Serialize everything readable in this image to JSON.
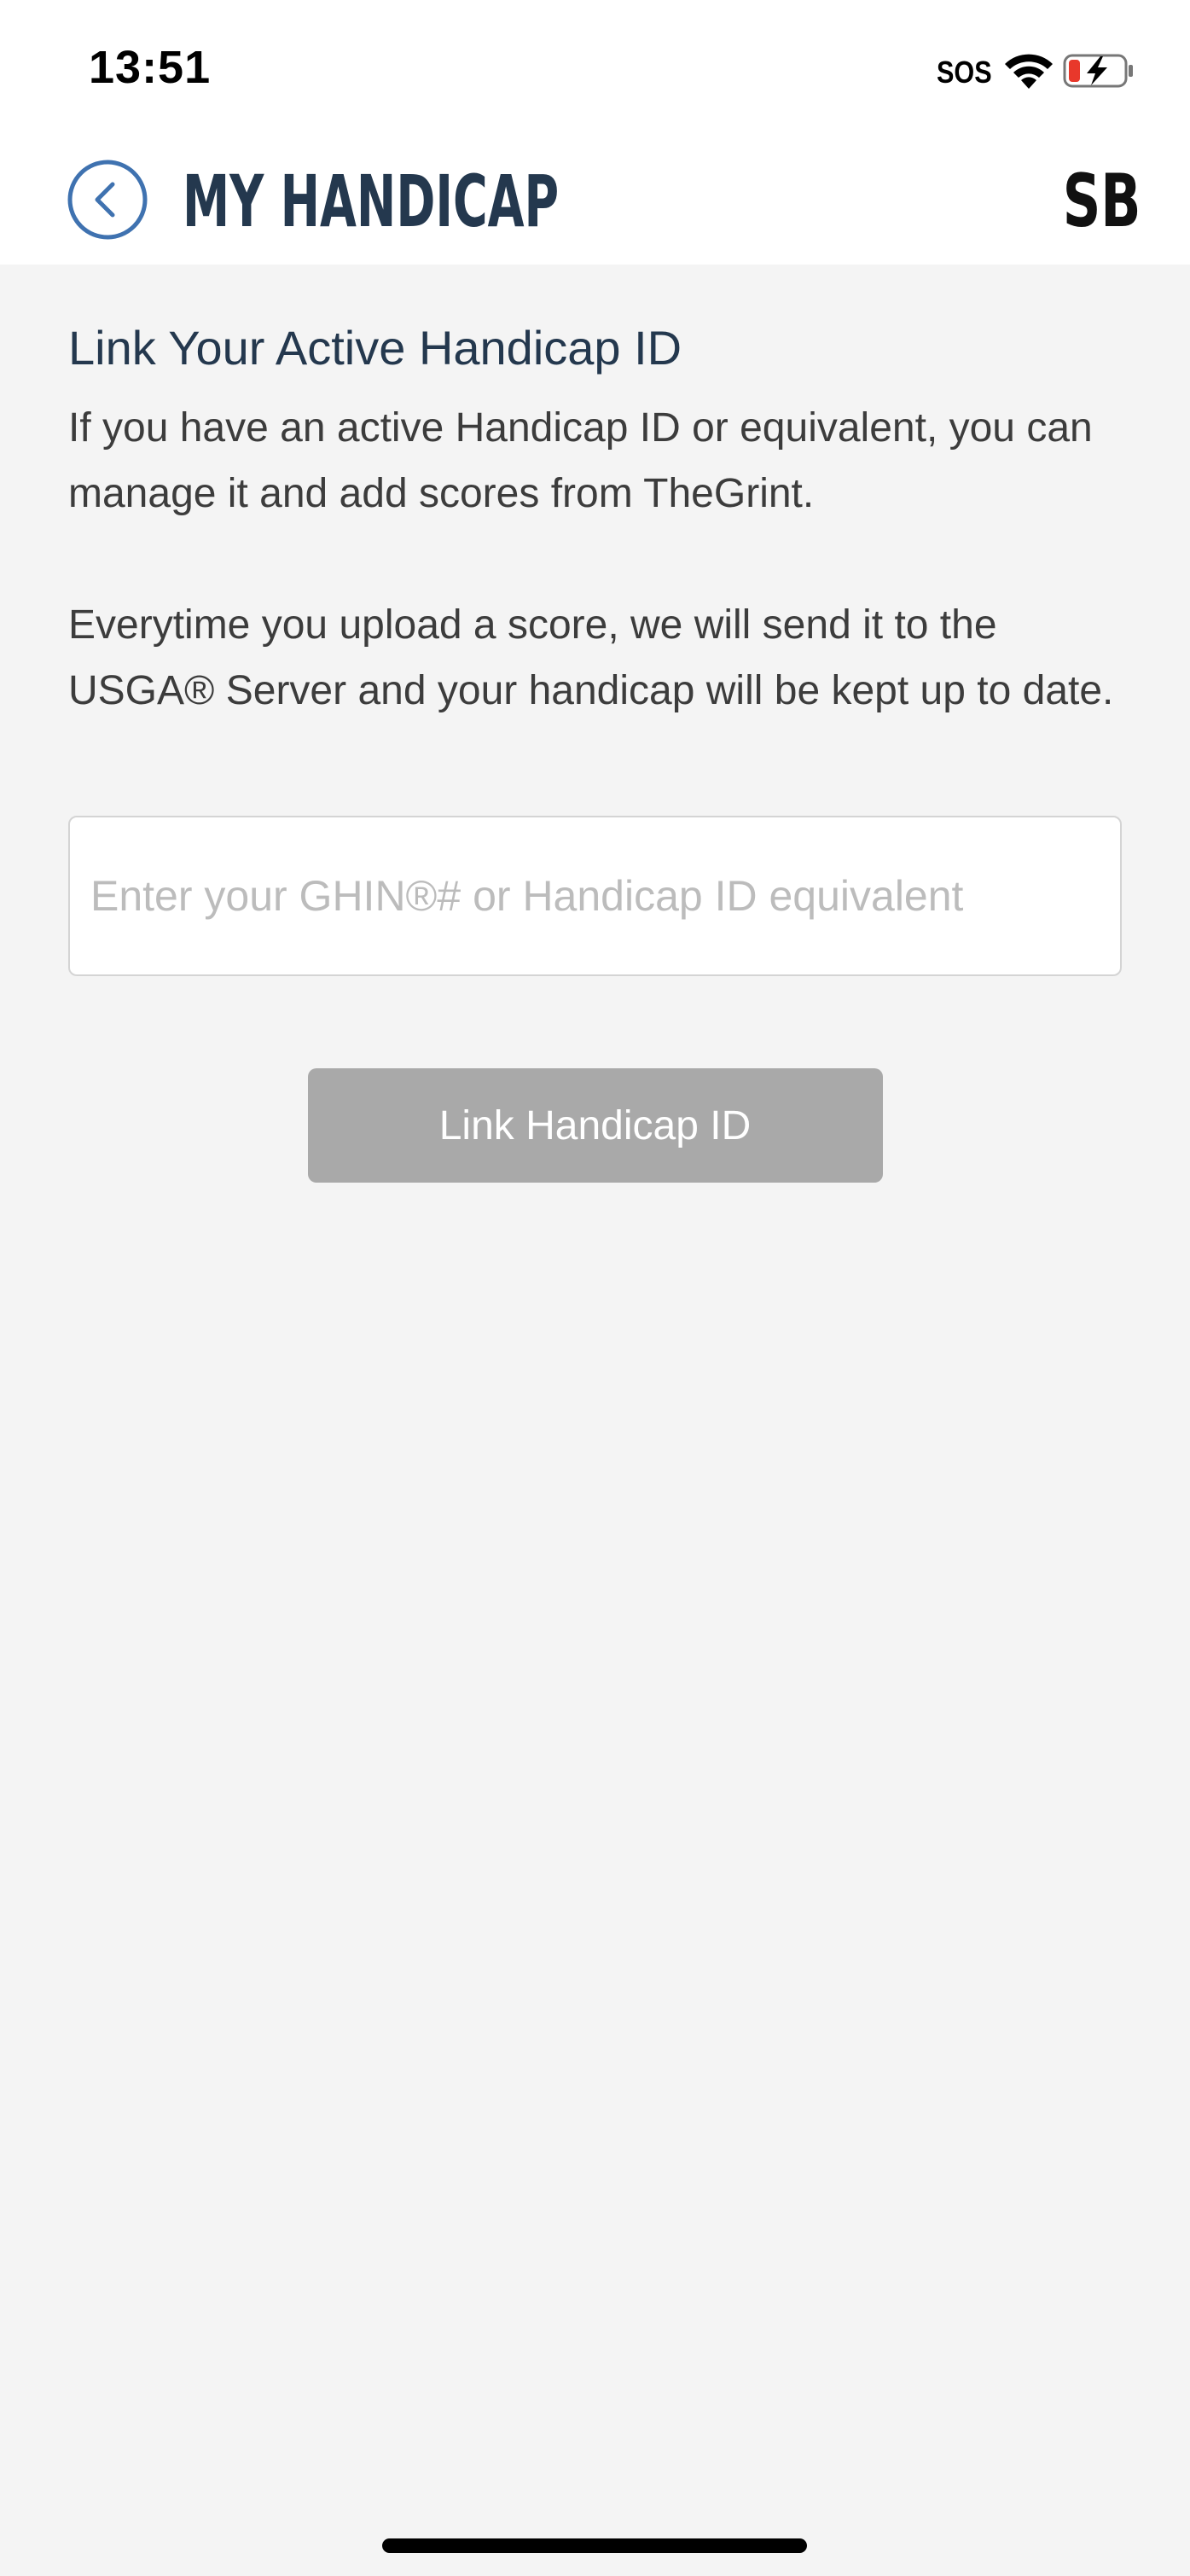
{
  "status_bar": {
    "time": "13:51",
    "carrier": "SOS",
    "icons": [
      "wifi-icon",
      "battery-charging-icon"
    ],
    "battery_color": "#e8382b"
  },
  "header": {
    "title": "MY HANDICAP",
    "avatar_initials": "SB",
    "back_icon": "chevron-left-icon",
    "accent_color": "#3f72b0"
  },
  "main": {
    "section_title": "Link Your Active Handicap ID",
    "paragraph_1": "If you have an active Handicap ID or equivalent, you can manage it and add scores from TheGrint.",
    "paragraph_2": "Everytime you upload a score, we will send it to the USGA® Server and your handicap will be kept up to date.",
    "input": {
      "value": "",
      "placeholder": "Enter your GHIN®# or Handicap ID equivalent"
    },
    "link_button_label": "Link Handicap ID",
    "link_button_color": "#a9a9a9"
  }
}
